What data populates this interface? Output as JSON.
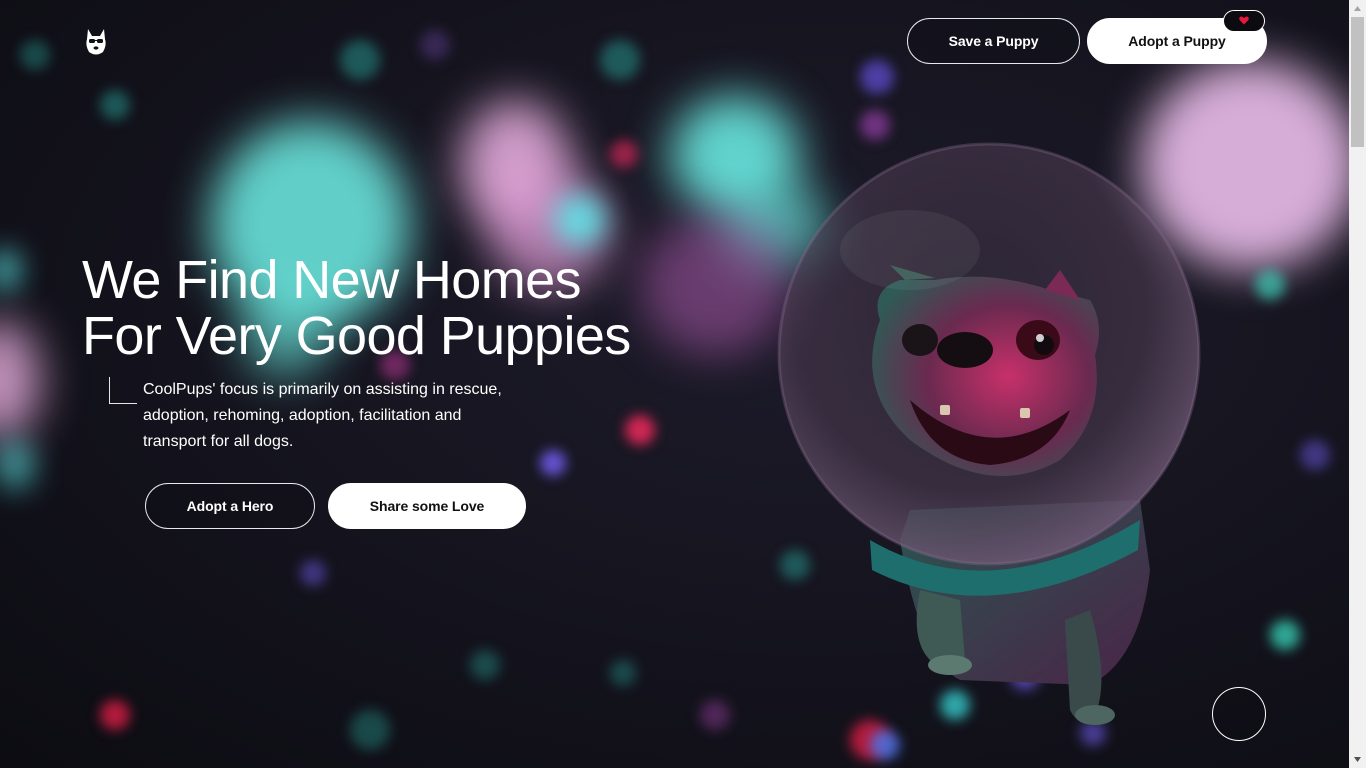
{
  "header": {
    "save_label": "Save a Puppy",
    "adopt_label": "Adopt a Puppy",
    "badge_icon": "heart-icon"
  },
  "hero": {
    "title_line1": "We Find New Homes",
    "title_line2": "For Very Good Puppies",
    "description": "CoolPups' focus is primarily on assisting in rescue, adoption, rehoming, adoption, facilitation and transport for all dogs.",
    "cta_primary": "Adopt a Hero",
    "cta_secondary": "Share some Love"
  },
  "colors": {
    "background": "#14131d",
    "accent_cyan": "#5ff5e8",
    "accent_pink": "#f0b0e8",
    "accent_red": "#e8183c",
    "button_light": "#ffffff"
  },
  "icons": {
    "logo": "dog-logo-icon",
    "scroll": "scroll-indicator-icon"
  }
}
